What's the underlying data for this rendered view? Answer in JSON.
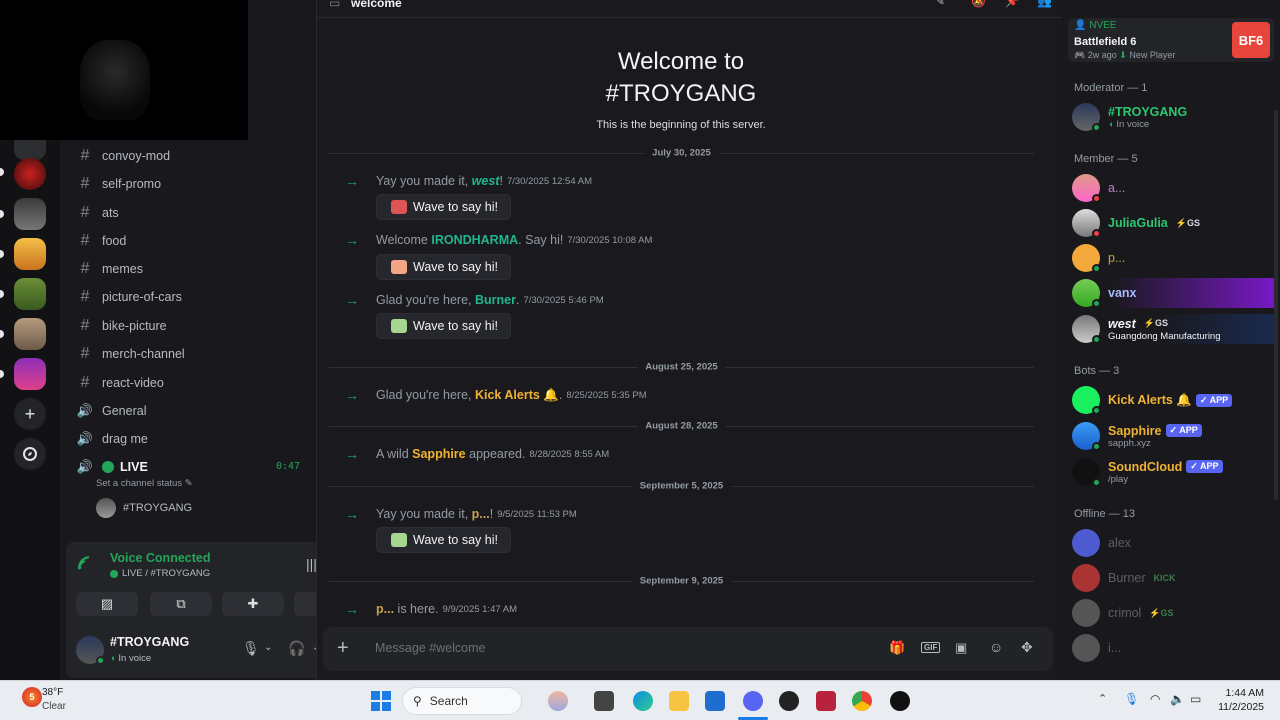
{
  "channels": {
    "items": [
      {
        "type": "text",
        "label": "convoy-mod"
      },
      {
        "type": "text",
        "label": "self-promo"
      },
      {
        "type": "text",
        "label": "ats"
      },
      {
        "type": "text",
        "label": "food"
      },
      {
        "type": "text",
        "label": "memes"
      },
      {
        "type": "text",
        "label": "picture-of-cars"
      },
      {
        "type": "text",
        "label": "bike-picture"
      },
      {
        "type": "text",
        "label": "merch-channel"
      },
      {
        "type": "text",
        "label": "react-video"
      },
      {
        "type": "voice",
        "label": "General"
      },
      {
        "type": "voice",
        "label": "drag me"
      }
    ],
    "live": {
      "label": "LIVE",
      "timer": "0:47",
      "status_placeholder": "Set a channel status",
      "member": "#TROYGANG"
    }
  },
  "voice_panel": {
    "title": "Voice Connected",
    "subtitle": "LIVE / #TROYGANG"
  },
  "user_panel": {
    "name": "#TROYGANG",
    "status": "In voice"
  },
  "chat": {
    "topbar_title": "welcome",
    "welcome_line1": "Welcome to",
    "welcome_line2": "#TROYGANG",
    "welcome_sub": "This is the beginning of this server.",
    "wave_label": "Wave to say hi!",
    "dates": [
      "July 30, 2025",
      "August 25, 2025",
      "August 28, 2025",
      "September 5, 2025",
      "September 9, 2025"
    ],
    "messages": [
      {
        "pre": "Yay you made it, ",
        "name": "west",
        "post": "!",
        "ts": "7/30/2025 12:54 AM"
      },
      {
        "pre": "Welcome ",
        "name": "IRONDHARMA",
        "post": ". Say hi!",
        "ts": "7/30/2025 10:08 AM"
      },
      {
        "pre": "Glad you're here, ",
        "name": "Burner",
        "post": ".",
        "ts": "7/30/2025 5:46 PM"
      },
      {
        "pre": "Glad you're here, ",
        "name": "Kick Alerts 🔔",
        "post": ".",
        "ts": "8/25/2025 5:35 PM"
      },
      {
        "pre": "A wild ",
        "name": "Sapphire",
        "post": " appeared.",
        "ts": "8/28/2025 8:55 AM"
      },
      {
        "pre": "Yay you made it, ",
        "name": "p...",
        "post": "!",
        "ts": "9/5/2025 11:53 PM"
      },
      {
        "pre": "",
        "name": "p...",
        "post": " is here.",
        "ts": "9/9/2025 1:47 AM"
      }
    ],
    "composer_placeholder": "Message #welcome"
  },
  "members": {
    "activity": {
      "user": "NVEE",
      "game": "Battlefield 6",
      "meta": "2w ago",
      "meta2": "New Player",
      "art": "BF6"
    },
    "moderator_header": "Moderator — 1",
    "moderator": {
      "name": "#TROYGANG",
      "sub": "In voice"
    },
    "member_header": "Member — 5",
    "list": [
      {
        "name": "a...",
        "badge": ""
      },
      {
        "name": "JuliaGulia",
        "badge": "⚡GS"
      },
      {
        "name": "p...",
        "badge": ""
      },
      {
        "name": "vanx",
        "badge": ""
      },
      {
        "name": "west",
        "badge": "⚡GS",
        "sub": "Guangdong Manufacturing"
      }
    ],
    "bots_header": "Bots — 3",
    "bots": [
      {
        "name": "Kick Alerts 🔔",
        "badge": "✓ APP",
        "sub": ""
      },
      {
        "name": "Sapphire",
        "badge": "✓ APP",
        "sub": "sapph.xyz"
      },
      {
        "name": "SoundCloud",
        "badge": "✓ APP",
        "sub": "/play"
      }
    ],
    "offline_header": "Offline — 13",
    "offline": [
      {
        "name": "alex",
        "badge": ""
      },
      {
        "name": "Burner",
        "badge": "KICK"
      },
      {
        "name": "crimol",
        "badge": "⚡GS"
      },
      {
        "name": "i...",
        "badge": ""
      }
    ]
  },
  "taskbar": {
    "weather_temp": "38°F",
    "weather_cond": "Clear",
    "weather_badge": "5",
    "search_label": "Search",
    "time": "1:44 AM",
    "date": "11/2/2025"
  },
  "colors": {
    "accent": "#5865f2",
    "online": "#23a55a",
    "dnd": "#f23f43",
    "mention": "#3ba55c"
  }
}
